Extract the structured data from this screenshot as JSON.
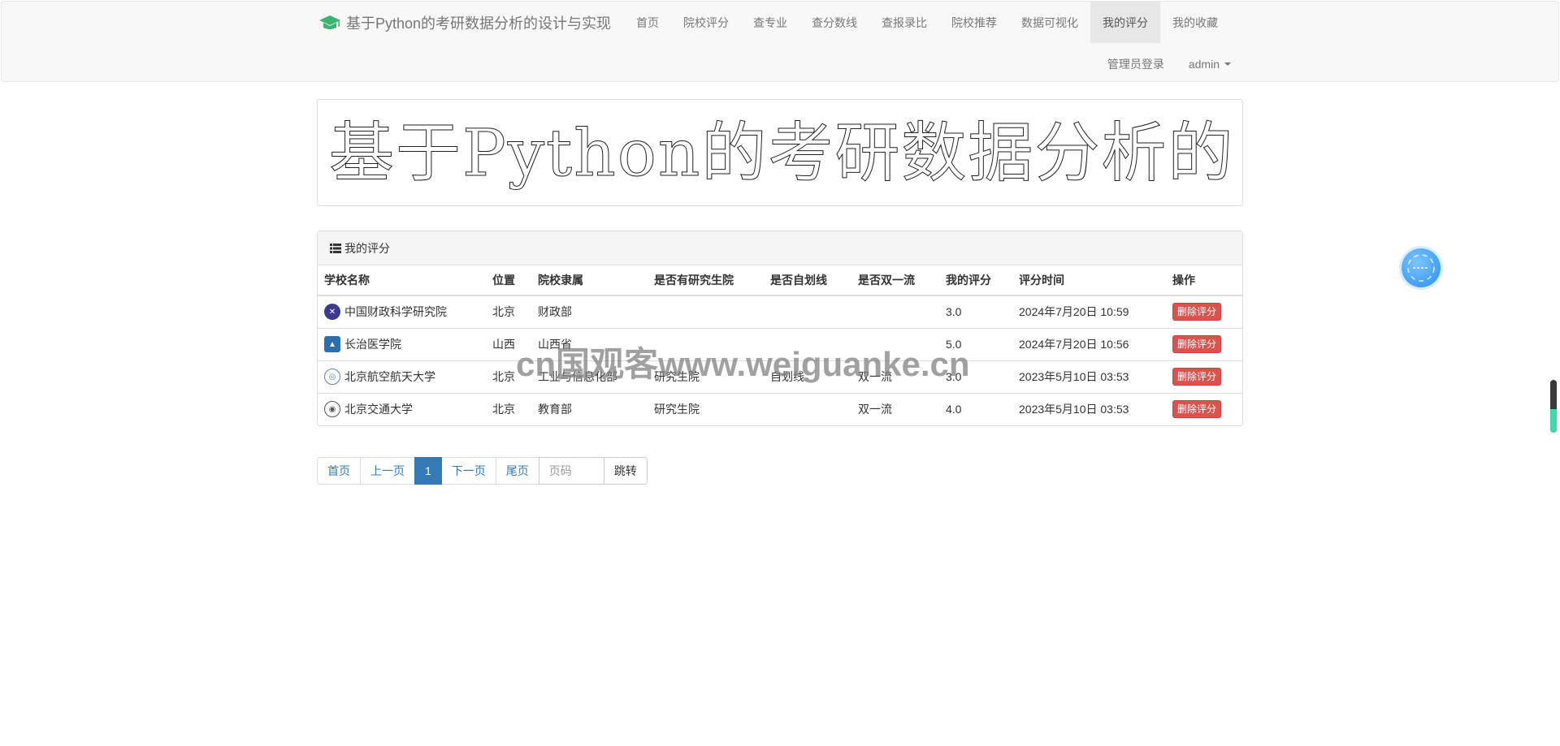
{
  "navbar": {
    "brand": "基于Python的考研数据分析的设计与实现",
    "items": [
      {
        "label": "首页"
      },
      {
        "label": "院校评分"
      },
      {
        "label": "查专业"
      },
      {
        "label": "查分数线"
      },
      {
        "label": "查报录比"
      },
      {
        "label": "院校推荐"
      },
      {
        "label": "数据可视化"
      },
      {
        "label": "我的评分",
        "active": true
      },
      {
        "label": "我的收藏"
      }
    ],
    "admin_login": "管理员登录",
    "user": "admin"
  },
  "banner": {
    "text": "基于Python的考研数据分析的设计与实现"
  },
  "panel": {
    "title": "我的评分",
    "columns": [
      "学校名称",
      "位置",
      "院校隶属",
      "是否有研究生院",
      "是否自划线",
      "是否双一流",
      "我的评分",
      "评分时间",
      "操作"
    ],
    "rows": [
      {
        "name": "中国财政科学研究院",
        "location": "北京",
        "affiliation": "财政部",
        "grad_school": "",
        "self_line": "",
        "double_first": "",
        "score": "3.0",
        "time": "2024年7月20日 10:59",
        "action": "删除评分",
        "logo_color": "#3c3a8f"
      },
      {
        "name": "长治医学院",
        "location": "山西",
        "affiliation": "山西省",
        "grad_school": "",
        "self_line": "",
        "double_first": "",
        "score": "5.0",
        "time": "2024年7月20日 10:56",
        "action": "删除评分",
        "logo_color": "#2a6fb0"
      },
      {
        "name": "北京航空航天大学",
        "location": "北京",
        "affiliation": "工业与信息化部",
        "grad_school": "研究生院",
        "self_line": "自划线",
        "double_first": "双一流",
        "score": "3.0",
        "time": "2023年5月10日 03:53",
        "action": "删除评分",
        "logo_color": "#5b84c4"
      },
      {
        "name": "北京交通大学",
        "location": "北京",
        "affiliation": "教育部",
        "grad_school": "研究生院",
        "self_line": "",
        "double_first": "双一流",
        "score": "4.0",
        "time": "2023年5月10日 03:53",
        "action": "删除评分",
        "logo_color": "#555555"
      }
    ]
  },
  "pagination": {
    "first": "首页",
    "prev": "上一页",
    "current": "1",
    "next": "下一页",
    "last": "尾页",
    "input_placeholder": "页码",
    "go": "跳转"
  },
  "watermark": "cn国观客www.weiguanke.cn",
  "side_progress": 0.45,
  "colors": {
    "active_page": "#337ab7",
    "delete_button": "#d9534f",
    "brand_icon": "#3cb371"
  }
}
